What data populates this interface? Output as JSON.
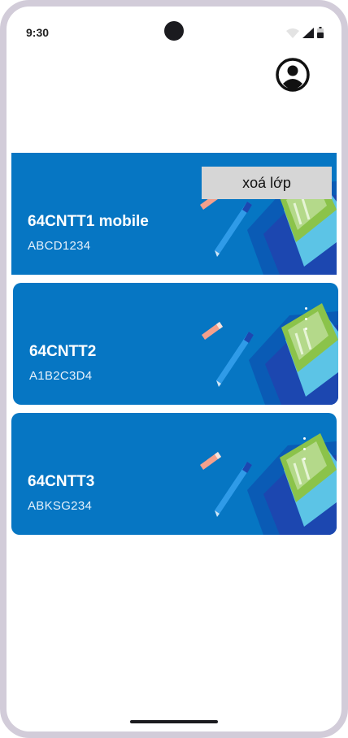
{
  "status_bar": {
    "time": "9:30",
    "icons": [
      "wifi-icon",
      "signal-icon",
      "battery-icon"
    ]
  },
  "header": {
    "profile_icon": "account-circle-icon"
  },
  "classes": [
    {
      "name": "64CNTT1 mobile",
      "code": "ABCD1234"
    },
    {
      "name": "64CNTT2",
      "code": "A1B2C3D4"
    },
    {
      "name": "64CNTT3",
      "code": "ABKSG234"
    }
  ],
  "context_menu": {
    "delete_label": "xoá lớp"
  },
  "colors": {
    "card_background": "#0676c3",
    "frame": "#d2ccd9",
    "menu_background": "#d6d6d6"
  }
}
